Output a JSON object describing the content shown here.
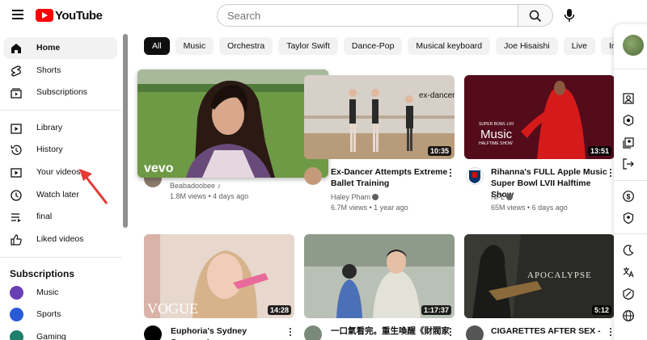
{
  "header": {
    "logo_text": "YouTube",
    "search_placeholder": "Search"
  },
  "sidebar": {
    "items": [
      {
        "label": "Home",
        "icon": "home-icon"
      },
      {
        "label": "Shorts",
        "icon": "shorts-icon"
      },
      {
        "label": "Subscriptions",
        "icon": "subscriptions-icon"
      },
      {
        "label": "Library",
        "icon": "library-icon"
      },
      {
        "label": "History",
        "icon": "history-icon"
      },
      {
        "label": "Your videos",
        "icon": "your-videos-icon"
      },
      {
        "label": "Watch later",
        "icon": "watch-later-icon"
      },
      {
        "label": "final",
        "icon": "playlist-icon"
      },
      {
        "label": "Liked videos",
        "icon": "like-icon"
      }
    ],
    "subscriptions_title": "Subscriptions",
    "subscriptions": [
      {
        "label": "Music",
        "color": "#6a3fb5"
      },
      {
        "label": "Sports",
        "color": "#2a5bd7"
      },
      {
        "label": "Gaming",
        "color": "#1e7f6b"
      }
    ]
  },
  "chips": [
    "All",
    "Music",
    "Orchestra",
    "Taylor Swift",
    "Dance-Pop",
    "Musical keyboard",
    "Joe Hisaishi",
    "Live",
    "Indie Mus"
  ],
  "videos": [
    {
      "title": "",
      "channel": "Beabadoobee",
      "views": "1.8M views",
      "age": "4 days ago",
      "duration": "",
      "watermark": "vevo"
    },
    {
      "title": "Ex-Dancer Attempts Extreme Ballet Training",
      "channel": "Haley Pham",
      "views": "6.7M views",
      "age": "1 year ago",
      "duration": "10:35",
      "overlay": "ex-dancer"
    },
    {
      "title": "Rihanna's FULL Apple Music Super Bowl LVII Halftime Show",
      "channel": "NFL",
      "views": "65M views",
      "age": "6 days ago",
      "duration": "13:51",
      "overlay_small": "SUPER BOWL LVII",
      "overlay_big": "Music",
      "overlay_sub": "HALFTIME SHOW"
    },
    {
      "title": "Euphoria's Sydney Sweeney's",
      "channel": "",
      "views": "",
      "age": "",
      "duration": "14:28",
      "overlay": "VOGUE"
    },
    {
      "title": "一口氣看完。重生喚醒《財閥家",
      "channel": "",
      "views": "",
      "age": "",
      "duration": "1:17:37"
    },
    {
      "title": "CIGARETTES AFTER SEX -",
      "channel": "",
      "views": "",
      "age": "",
      "duration": "5:12",
      "overlay": "APOCALYPSE"
    }
  ],
  "colors": {
    "brand": "#ff0000",
    "chip_active": "#0f0f0f",
    "arrow": "#e53935"
  }
}
